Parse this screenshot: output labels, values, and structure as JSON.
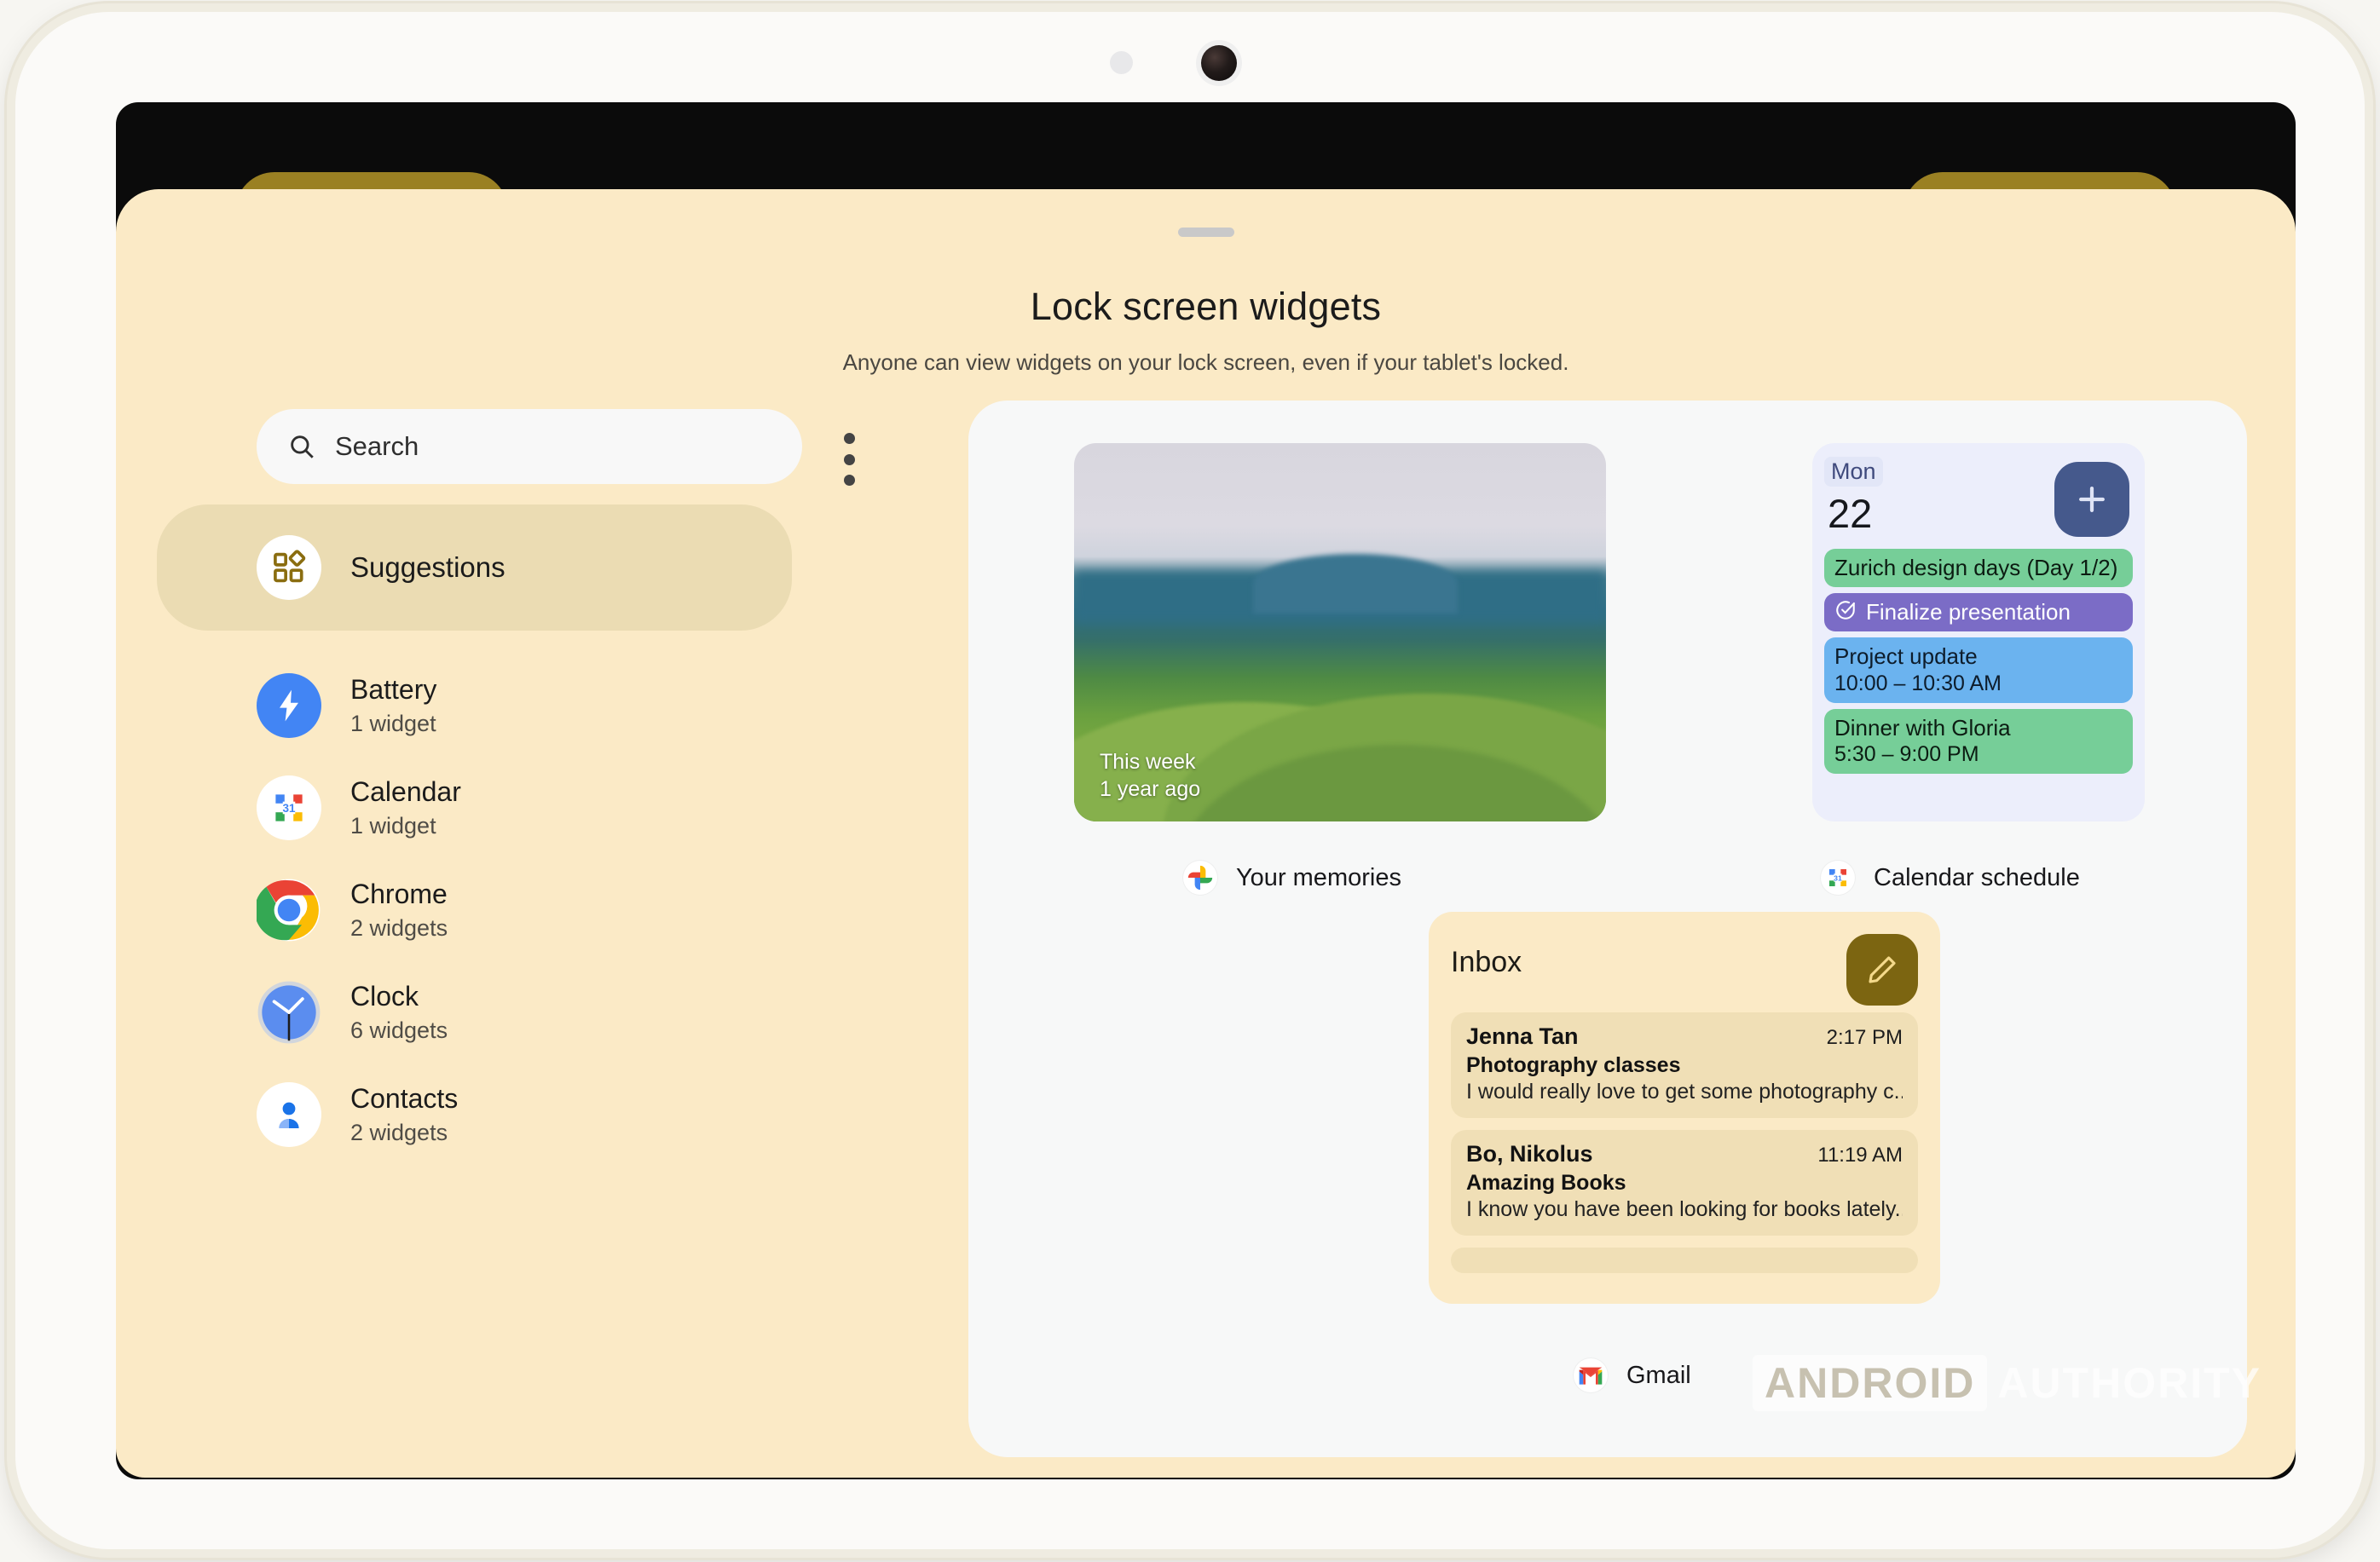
{
  "sheet": {
    "title": "Lock screen widgets",
    "subtitle": "Anyone can view widgets on your lock screen, even if your tablet's locked."
  },
  "search": {
    "placeholder": "Search",
    "icon": "search-icon"
  },
  "overflow": {
    "icon": "more-vert-icon"
  },
  "sidebar": {
    "items": [
      {
        "label": "Suggestions",
        "count": "",
        "icon": "widgets-grid-icon",
        "selected": true
      },
      {
        "label": "Battery",
        "count": "1 widget",
        "icon": "battery-bolt-icon",
        "selected": false
      },
      {
        "label": "Calendar",
        "count": "1 widget",
        "icon": "google-calendar-icon",
        "selected": false
      },
      {
        "label": "Chrome",
        "count": "2 widgets",
        "icon": "chrome-icon",
        "selected": false
      },
      {
        "label": "Clock",
        "count": "6 widgets",
        "icon": "clock-icon",
        "selected": false
      },
      {
        "label": "Contacts",
        "count": "2 widgets",
        "icon": "contacts-icon",
        "selected": false
      }
    ]
  },
  "widgets": {
    "memories": {
      "caption": "Your memories",
      "caption_icon": "google-photos-icon",
      "overlay_line1": "This week",
      "overlay_line2": "1 year ago"
    },
    "calendar": {
      "caption": "Calendar schedule",
      "caption_icon": "google-calendar-icon",
      "day_of_week": "Mon",
      "day_number": "22",
      "add_icon": "plus-icon",
      "events": [
        {
          "title": "Zurich design days (Day 1/2)",
          "time": "",
          "color": "#76ce98",
          "style": "green",
          "has_check": false
        },
        {
          "title": "Finalize presentation",
          "time": "",
          "color": "#7b6cc6",
          "style": "purple",
          "has_check": true
        },
        {
          "title": "Project update",
          "time": "10:00 – 10:30 AM",
          "color": "#6bb3ef",
          "style": "blue",
          "has_check": false
        },
        {
          "title": "Dinner with Gloria",
          "time": "5:30 – 9:00 PM",
          "color": "#76ce98",
          "style": "green",
          "has_check": false
        }
      ]
    },
    "gmail": {
      "caption": "Gmail",
      "caption_icon": "gmail-icon",
      "inbox_label": "Inbox",
      "compose_icon": "pencil-icon",
      "emails": [
        {
          "from": "Jenna Tan",
          "time": "2:17 PM",
          "subject": "Photography classes",
          "snippet": "I would really love to get some photography c..."
        },
        {
          "from": "Bo, Nikolus",
          "time": "11:19 AM",
          "subject": "Amazing Books",
          "snippet": "I know you have been looking for books lately...."
        }
      ]
    }
  },
  "watermark": {
    "brand": "ANDROID",
    "word": "AUTHORITY"
  },
  "colors": {
    "sheet_bg": "#fbeac6",
    "panel_bg": "#f7f8f8",
    "selected_pill": "#ebdcb3",
    "calendar_widget_bg": "#eceefb",
    "calendar_add_button": "#45598c",
    "gmail_widget_bg": "#fbeac6",
    "gmail_item_bg": "#f0dfb6",
    "gmail_compose_button": "#7c6511",
    "accent_gold": "#9a8023"
  }
}
